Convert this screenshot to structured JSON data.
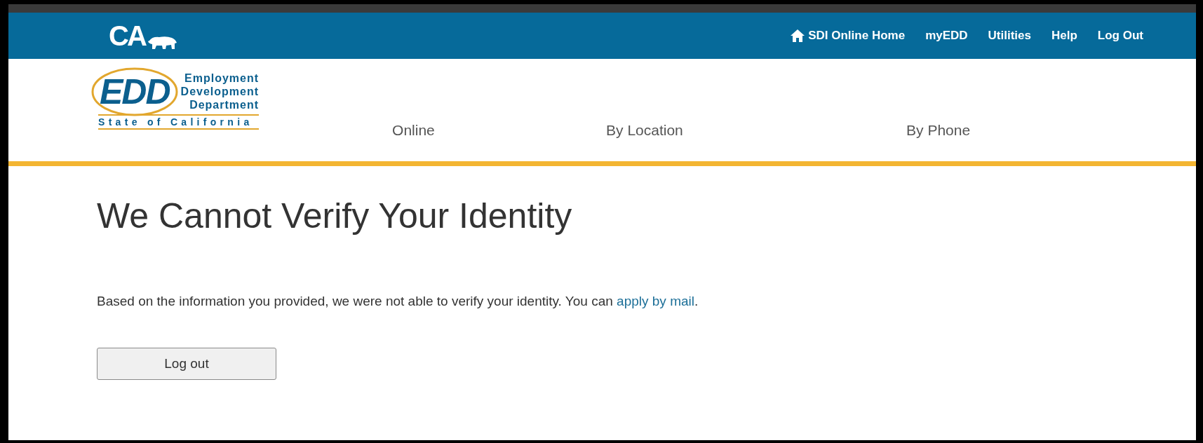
{
  "top_bar": {
    "logo": "CA",
    "links": [
      {
        "label": "SDI Online Home",
        "kind": "home"
      },
      {
        "label": "myEDD"
      },
      {
        "label": "Utilities"
      },
      {
        "label": "Help"
      },
      {
        "label": "Log Out"
      }
    ]
  },
  "brand": {
    "mark": "EDD",
    "lines": [
      "Employment",
      "Development",
      "Department"
    ],
    "state": "State of California"
  },
  "nav": [
    "Online",
    "By Location",
    "By Phone"
  ],
  "page": {
    "title": "We Cannot Verify Your Identity",
    "message": {
      "text": "Based on the information you provided, we were not able to verify your identity. You can ",
      "link": "apply by mail",
      "after": "."
    },
    "button": "Log out"
  }
}
